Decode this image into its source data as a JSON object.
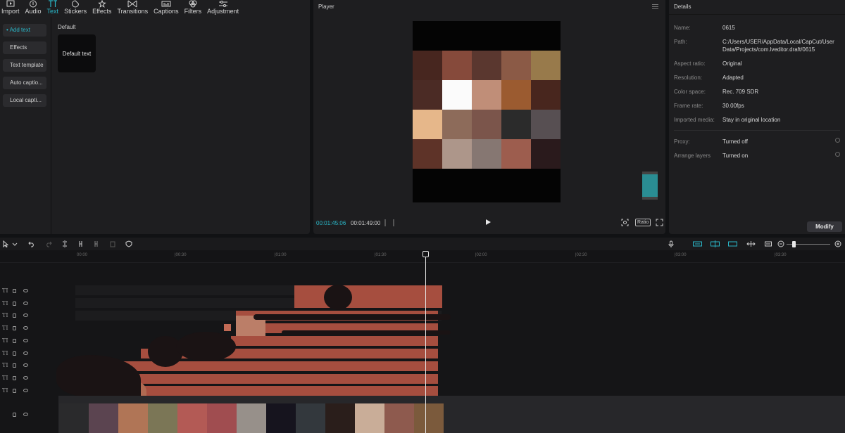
{
  "media_tabs": [
    {
      "label": "Import",
      "icon": "import-icon",
      "active": false
    },
    {
      "label": "Audio",
      "icon": "audio-icon",
      "active": false
    },
    {
      "label": "Text",
      "icon": "text-icon",
      "active": true
    },
    {
      "label": "Stickers",
      "icon": "stickers-icon",
      "active": false
    },
    {
      "label": "Effects",
      "icon": "effects-icon",
      "active": false
    },
    {
      "label": "Transitions",
      "icon": "transitions-icon",
      "active": false
    },
    {
      "label": "Captions",
      "icon": "captions-icon",
      "active": false
    },
    {
      "label": "Filters",
      "icon": "filters-icon",
      "active": false
    },
    {
      "label": "Adjustment",
      "icon": "adjustment-icon",
      "active": false
    }
  ],
  "text_sidebar": [
    {
      "label": "• Add text",
      "active": true
    },
    {
      "label": "Effects",
      "active": false
    },
    {
      "label": "Text template",
      "active": false
    },
    {
      "label": "Auto captio...",
      "active": false
    },
    {
      "label": "Local capti...",
      "active": false
    }
  ],
  "text_library": {
    "section_label": "Default",
    "card_label": "Default text"
  },
  "player": {
    "title": "Player",
    "current_time": "00:01:45:06",
    "duration": "00:01:49:00",
    "ratio_label": "Ratio",
    "accent": "#29b7c8",
    "mosaic_colors": [
      "#47261f",
      "#864a3b",
      "#5a372f",
      "#8b5a46",
      "#987a4b",
      "#4b2b25",
      "#fbfbfb",
      "#c08e78",
      "#9b5b30",
      "#48261e",
      "#e6b78a",
      "#8d6b5a",
      "#7b554b",
      "#2b2b2b",
      "#574f52",
      "#5e3328",
      "#ad968a",
      "#867772",
      "#9d5d4e",
      "#2a1a1c"
    ]
  },
  "details": {
    "title": "Details",
    "fields": [
      {
        "label": "Name:",
        "value": "0615"
      },
      {
        "label": "Path:",
        "value": "C:/Users/USER/AppData/Local/CapCut/User Data/Projects/com.lveditor.draft/0615"
      },
      {
        "label": "Aspect ratio:",
        "value": "Original"
      },
      {
        "label": "Resolution:",
        "value": "Adapted"
      },
      {
        "label": "Color space:",
        "value": "Rec. 709 SDR"
      },
      {
        "label": "Frame rate:",
        "value": "30.00fps"
      },
      {
        "label": "Imported media:",
        "value": "Stay in original location"
      }
    ],
    "settings": [
      {
        "label": "Proxy:",
        "value": "Turned off"
      },
      {
        "label": "Arrange layers",
        "value": "Turned on"
      }
    ],
    "modify_label": "Modify"
  },
  "timeline": {
    "ruler_labels": [
      "00:00",
      "|00:30",
      "|01:00",
      "|01:30",
      "|02:00",
      "|02:30",
      "|03:00",
      "|03:30"
    ],
    "track_glyph": "TI",
    "text_tracks": 9,
    "clip_color": "#a64e3f",
    "main_track_thumb_colors": [
      "#2a2a2c",
      "#5b4450",
      "#b07556",
      "#7b7656",
      "#b35a55",
      "#a04d50",
      "#97908a",
      "#16141e",
      "#33383d",
      "#2a1e1b",
      "#c9ad98",
      "#8e5a4e",
      "#7b5a3c"
    ]
  }
}
